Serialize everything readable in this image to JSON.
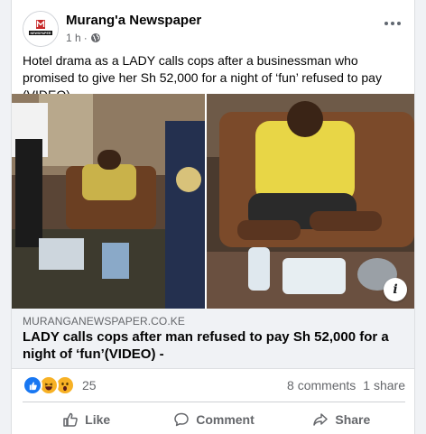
{
  "post": {
    "page_name": "Murang'a Newspaper",
    "avatar_text": "NEWSPAPER",
    "time": "1 h",
    "separator": "·",
    "privacy_icon": "globe-icon",
    "text": "Hotel drama as a LADY calls cops after a businessman who promised to give her Sh 52,000 for a night of ‘fun’ refused to pay (VIDEO)"
  },
  "link": {
    "domain": "MURANGANEWSPAPER.CO.KE",
    "title": "LADY calls cops after man refused to pay Sh 52,000 for a night of ‘fun’(VIDEO) -",
    "info_glyph": "i"
  },
  "stats": {
    "reaction_icons": [
      "like-icon",
      "haha-icon",
      "wow-icon"
    ],
    "reaction_count": "25",
    "comments": "8 comments",
    "shares": "1 share"
  },
  "actions": {
    "like": "Like",
    "comment": "Comment",
    "share": "Share"
  },
  "colors": {
    "like_blue": "#1877f2",
    "reaction_yellow": "#f7b125",
    "secondary_text": "#65676b",
    "link_box_bg": "#f0f2f5"
  }
}
